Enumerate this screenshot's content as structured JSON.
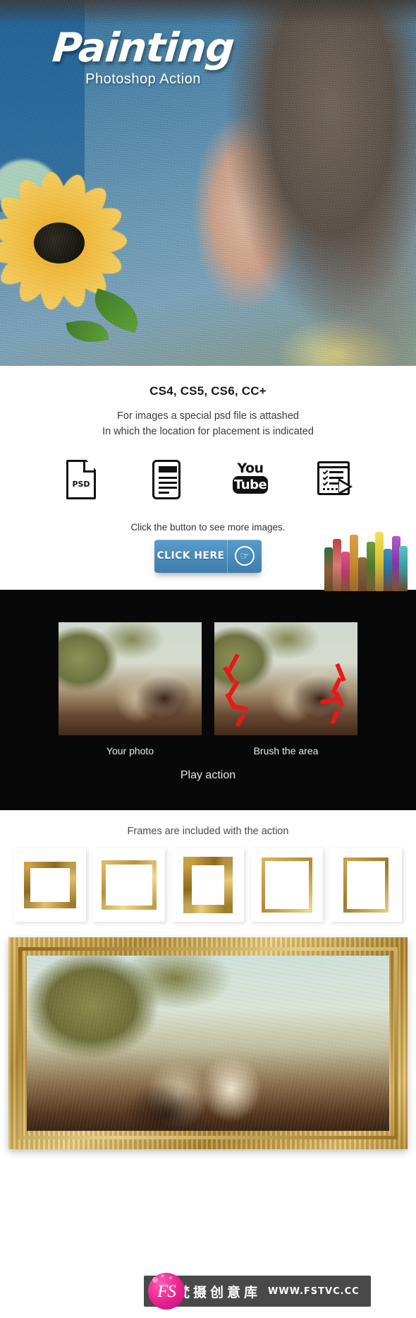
{
  "hero": {
    "title": "Painting",
    "subtitle": "Photoshop Action"
  },
  "info": {
    "compatibility": "CS4, CS5, CS6, CC+",
    "desc_line1": "For images a special psd file is attashed",
    "desc_line2": "In which the location for placement is indicated",
    "icons": [
      {
        "name": "psd-file-icon",
        "label": "PSD"
      },
      {
        "name": "readme-document-icon",
        "label": ""
      },
      {
        "name": "youtube-icon",
        "label_top": "You",
        "label_bottom": "Tube"
      },
      {
        "name": "checklist-play-icon",
        "label": ""
      }
    ]
  },
  "cta": {
    "text": "Click the button to see more images.",
    "button_label": "CLICK HERE",
    "button_icon": "hand-pointer-icon",
    "button_color": "#4a8cbb",
    "brushes_image": "paintbrushes"
  },
  "steps": {
    "photo_label": "Your photo",
    "brush_label": "Brush the area",
    "play_label": "Play action",
    "brush_stroke_color": "#ee1515",
    "background_color": "#080808"
  },
  "frames": {
    "title": "Frames are included with the action",
    "items": [
      {
        "name": "frame-ornate-wide"
      },
      {
        "name": "frame-thin-gold"
      },
      {
        "name": "frame-thick-gold"
      },
      {
        "name": "frame-slim-gold"
      },
      {
        "name": "frame-narrow-gold"
      }
    ]
  },
  "showcase": {
    "name": "framed-painting-preview"
  },
  "watermark": {
    "logo_text": "FS",
    "brand_cn": "梵摄创意库",
    "url": "WWW.FSTVC.CC",
    "logo_color": "#e81f8c"
  }
}
